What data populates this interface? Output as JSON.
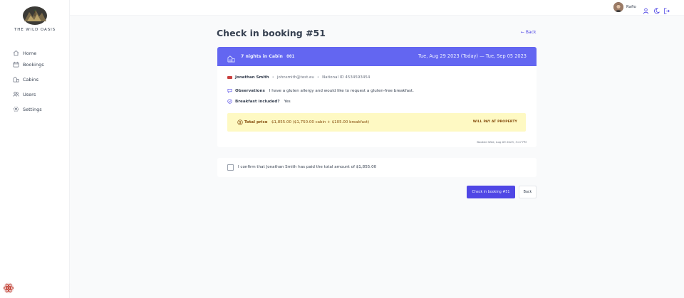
{
  "sidebar": {
    "brand": "THE WILD OASIS",
    "items": [
      {
        "label": "Home",
        "icon": "home-icon"
      },
      {
        "label": "Bookings",
        "icon": "calendar-icon"
      },
      {
        "label": "Cabins",
        "icon": "cabins-icon"
      },
      {
        "label": "Users",
        "icon": "users-icon"
      },
      {
        "label": "Settings",
        "icon": "gear-icon"
      }
    ]
  },
  "header": {
    "username": "Rafio",
    "icons": [
      "user-icon",
      "moon-icon",
      "logout-icon"
    ]
  },
  "page": {
    "title": "Check in booking #51",
    "back_link": "← Back"
  },
  "booking": {
    "nights_text": "7 nights in Cabin",
    "cabin_code": "001",
    "dates": "Tue, Aug 29 2023 (Today) — Tue, Sep 05 2023",
    "guest_name": "Jonathan Smith",
    "guest_email": "johnsmith@test.eu",
    "national_id": "National ID 4534593454",
    "observations_label": "Observations",
    "observations_text": "I have a gluten allergy and would like to request a gluten-free breakfast.",
    "breakfast_label": "Breakfast included?",
    "breakfast_value": "Yes",
    "price_label": "Total price",
    "price_value": "$1,855.00 ($1,750.00 cabin + $105.00 breakfast)",
    "payment_status": "WILL PAY AT PROPERTY",
    "booked_at": "Booked Wed, Aug 09 2023, 3:47 PM"
  },
  "confirm": {
    "text": "I confirm that Jonathan Smith has paid the total amount of $1,855.00",
    "checked": false
  },
  "actions": {
    "checkin_label": "Check in booking #51",
    "back_label": "Back"
  },
  "colors": {
    "brand": "#4f46e5",
    "banner": "#6366f1",
    "price_bg": "#fef9c3",
    "price_text": "#854d0e"
  }
}
